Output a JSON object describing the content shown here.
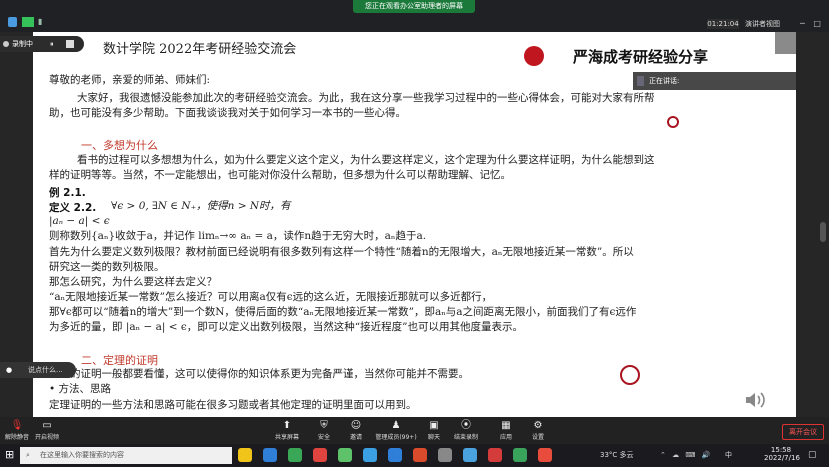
{
  "system": {
    "share_banner": "您正在观看办公室助理者的屏幕",
    "meeting_timer": "01:21:04",
    "view_button": "演讲者视图",
    "window_controls": "─ □ ✕"
  },
  "recording": {
    "label": "录制中",
    "pause_icon": "⏸"
  },
  "speaking": {
    "label": "正在讲话:"
  },
  "slide": {
    "header_left": "数计学院  2022年考研经验交流会",
    "header_right": "严海成考研经验分享",
    "greeting": "尊敬的老师，亲爱的师弟、师妹们:",
    "intro_1": "大家好，我很遗憾没能参加此次的考研经验交流会。为此，我在这分享一些我学习过程中的一些心得体会，可能对大家有所帮",
    "intro_2": "助，也可能没有多少帮助。下面我谈谈我对关于如何学习一本书的一些心得。",
    "h1": "一、多想为什么",
    "p1_1": "看书的过程可以多想想为什么，如为什么要定义这个定义，为什么要这样定义，这个定理为什么要这样证明，为什么能想到这",
    "p1_2": "样的证明等等。当然，不一定能想出，也可能对你没什么帮助，但多想为什么可以帮助理解、记忆。",
    "example": "例  2.1.",
    "def_label": "定义  2.2.",
    "def_text": "∀ϵ > 0, ∃N ∈ N₊，使得n > N时，有",
    "formula": "|aₙ − a| < ϵ",
    "line_a": "则称数列{aₙ}收敛于a，并记作  limₙ→∞ aₙ = a，读作n趋于无穷大时，aₙ趋于a.",
    "line_b": "首先为什么要定义数列极限？教材前面已经说明有很多数列有这样一个特性“随着n的无限增大，aₙ无限地接近某一常数”。所以",
    "line_c": "研究这一类的数列极限。",
    "line_d": "那怎么研究，为什么要这样去定义？",
    "line_e": "“aₙ无限地接近某一常数”怎么接近？可以用离a仅有ϵ远的这么近，无限接近那就可以多近都行，",
    "line_f": "那∀ϵ都可以“随着n的增大”到一个数N，使得后面的数“aₙ无限地接近某一常数”，即aₙ与a之间距离无限小，前面我们了有ϵ远作",
    "line_g": "为多近的量，即 |aₙ − a| < ϵ，即可以定义出数列极限，当然这种“接近程度”也可以用其他度量表示。",
    "h2": "二、定理的证明",
    "p2": "定理的证明一般都要看懂，这可以使得你的知识体系更为完备严谨，当然你可能并不需要。",
    "bullet": "• 方法、思路",
    "p3": "定理证明的一些方法和思路可能在很多习题或者其他定理的证明里面可以用到。"
  },
  "chat": {
    "placeholder": "说点什么..."
  },
  "toolbar": {
    "mute": "解除静音",
    "video": "开启视频",
    "share": "共享屏幕",
    "security": "安全",
    "invite": "邀请",
    "members": "管理成员(99+)",
    "chat": "聊天",
    "end_record": "结束录制",
    "apps": "应用",
    "settings": "设置",
    "leave": "离开会议"
  },
  "taskbar": {
    "search_placeholder": "在这里输入你要搜索的内容",
    "weather": "33°C  多云",
    "ime": "中",
    "time": "15:58",
    "date": "2022/7/16",
    "app_colors": [
      "#f0c419",
      "#2f7ed8",
      "#3aa757",
      "#e0443e",
      "#5ec26a",
      "#3ba0e3",
      "#2f7ed8",
      "#d94b2b",
      "#888888",
      "#4aa3df",
      "#d43b3b",
      "#39a35b",
      "#e84c3d"
    ]
  }
}
